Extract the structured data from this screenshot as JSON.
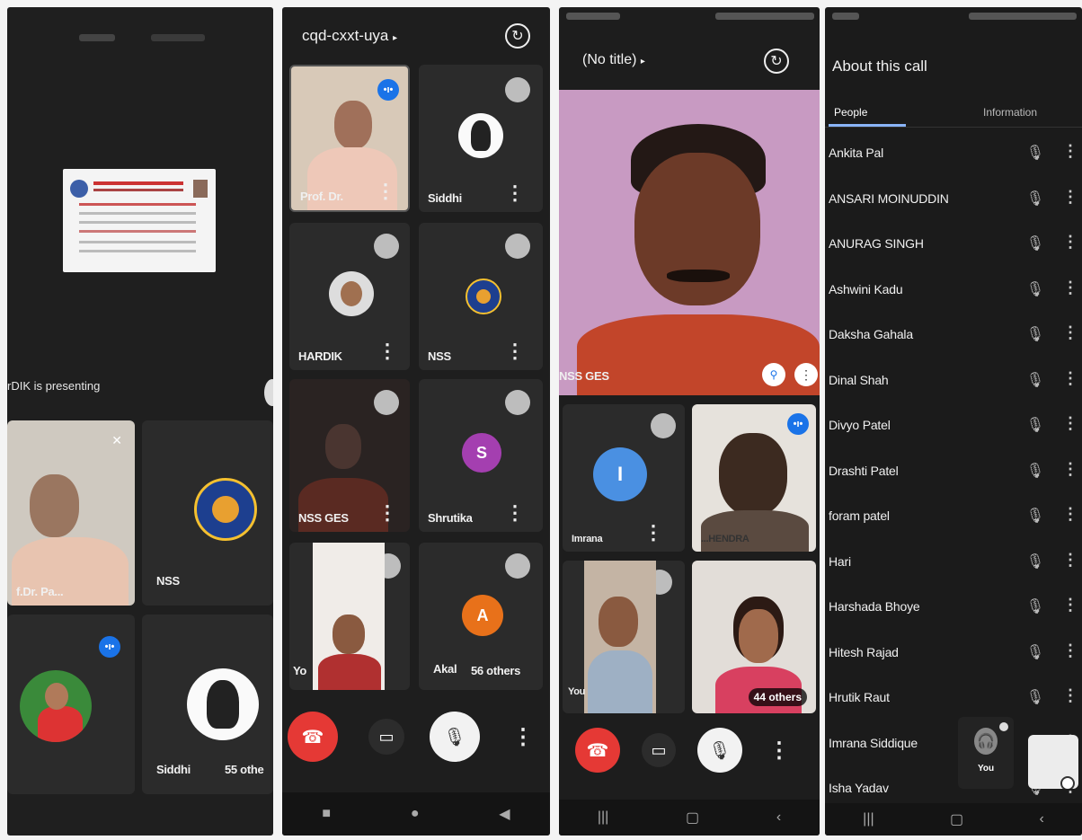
{
  "panel1": {
    "presenting_text": "rDIK is presenting",
    "tiles": [
      {
        "name": "f.Dr. Pa..."
      },
      {
        "name": "NSS"
      },
      {
        "name": "Siddhi"
      },
      {
        "name": "55 othe"
      }
    ]
  },
  "panel2": {
    "meeting_code": "cqd-cxxt-uya",
    "tiles": [
      {
        "name": "Prof. Dr."
      },
      {
        "name": "Siddhi"
      },
      {
        "name": "HARDIK"
      },
      {
        "name": "NSS"
      },
      {
        "name": "NSS GES"
      },
      {
        "name": "Shrutika",
        "initial": "S"
      },
      {
        "name": "Yo"
      },
      {
        "name": "Akal",
        "initial": "A"
      }
    ],
    "others": "56 others"
  },
  "panel3": {
    "title": "(No title)",
    "main_speaker": "NSS GES",
    "tiles": [
      {
        "name": "Imrana",
        "initial": "I"
      },
      {
        "name": "...HENDRA"
      },
      {
        "name": "You"
      }
    ],
    "others": "44 others"
  },
  "panel4": {
    "heading": "About this call",
    "tabs": {
      "people": "People",
      "information": "Information"
    },
    "people": [
      "Ankita Pal",
      "ANSARI MOINUDDIN",
      "ANURAG SINGH",
      "Ashwini Kadu",
      "Daksha Gahala",
      "Dinal Shah",
      "Divyo Patel",
      "Drashti Patel",
      "foram patel",
      "Hari",
      "Harshada Bhoye",
      "Hitesh Rajad",
      "Hrutik Raut",
      "Imrana Siddique",
      "Isha Yadav"
    ],
    "floating": {
      "you": "You"
    }
  },
  "colors": {
    "end_call": "#e53935",
    "accent": "#1a73e8",
    "background": "#1c1c1c"
  },
  "icons": {
    "end_call": "phone-hangup-icon",
    "camera": "camera-icon",
    "mic": "mic-off-icon",
    "more": "more-vert-icon",
    "switch_camera": "switch-camera-icon",
    "speaking": "speaking-indicator-icon",
    "pin": "pin-icon"
  }
}
